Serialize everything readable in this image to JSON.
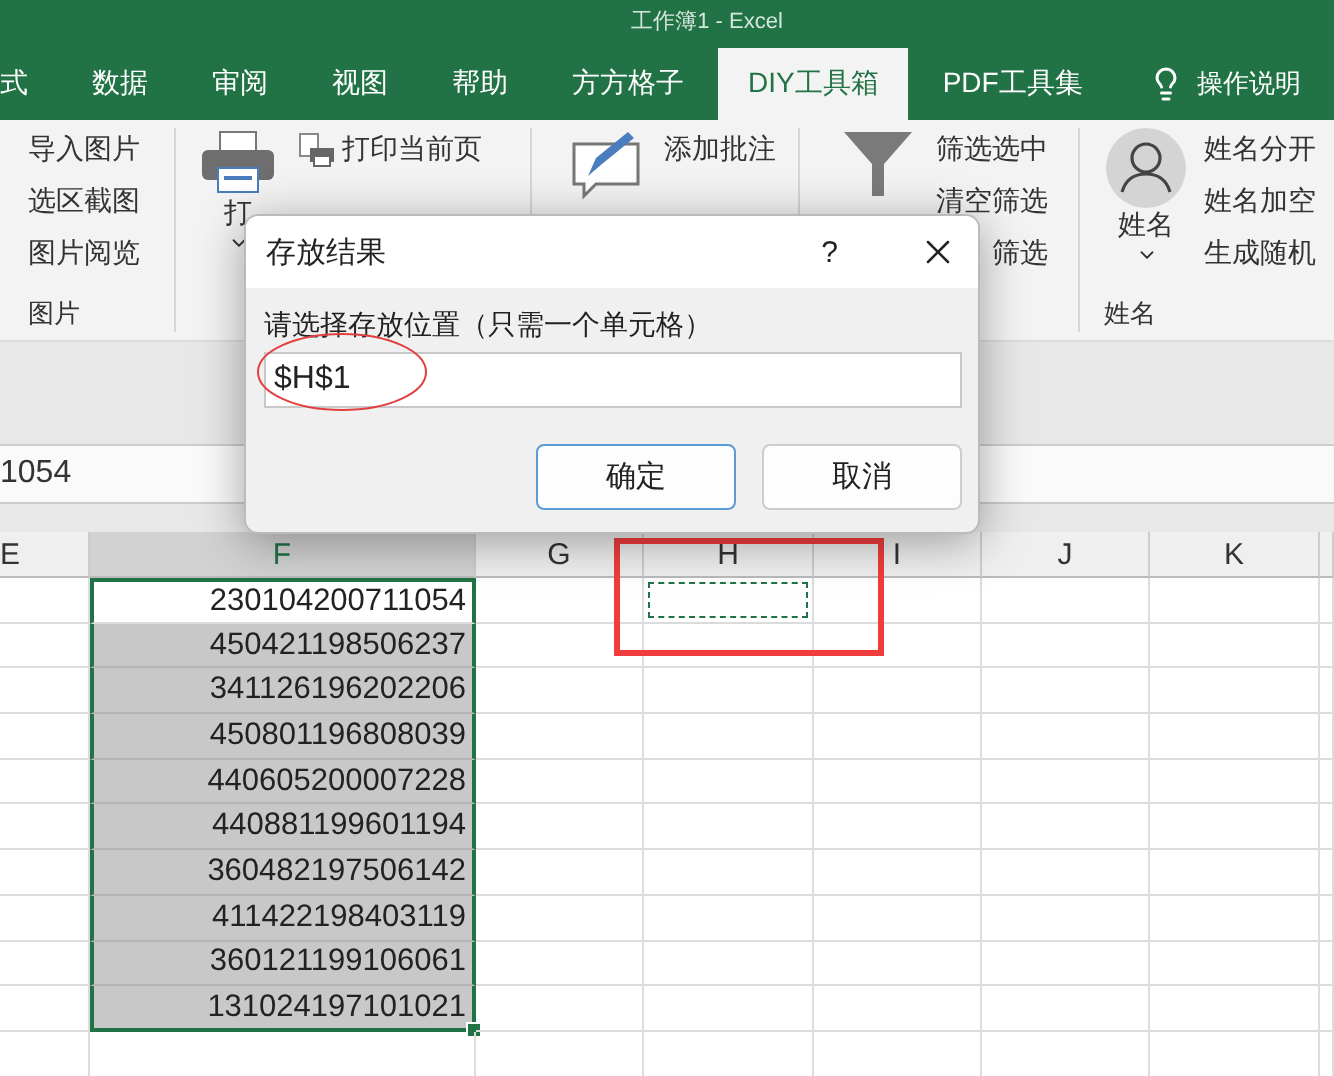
{
  "window": {
    "title": "工作簿1 - Excel"
  },
  "tabs": [
    {
      "label": "式",
      "selected": false
    },
    {
      "label": "数据",
      "selected": false
    },
    {
      "label": "审阅",
      "selected": false
    },
    {
      "label": "视图",
      "selected": false
    },
    {
      "label": "帮助",
      "selected": false
    },
    {
      "label": "方方格子",
      "selected": false
    },
    {
      "label": "DIY工具箱",
      "selected": true
    },
    {
      "label": "PDF工具集",
      "selected": false
    }
  ],
  "tell_me": {
    "label": "操作说明"
  },
  "ribbon": {
    "groups": [
      {
        "items": [
          {
            "label": "导入图片"
          },
          {
            "label": "选区截图"
          },
          {
            "label": "图片阅览"
          }
        ],
        "label": "图片"
      },
      {
        "button": {
          "kind": "printer",
          "label": "打",
          "dropdown": true
        },
        "items": [
          {
            "label": "打印当前页",
            "kind": "page"
          }
        ]
      },
      {
        "button": {
          "kind": "comment"
        },
        "items": [
          {
            "label": "添加批注"
          }
        ]
      },
      {
        "button": {
          "kind": "funnel"
        },
        "items": [
          {
            "label": "筛选选中"
          },
          {
            "label": "清空筛选"
          },
          {
            "label": "筛选",
            "covered": true
          }
        ]
      },
      {
        "button": {
          "kind": "person",
          "label": "姓名",
          "dropdown": true
        },
        "items": [
          {
            "label": "姓名分开"
          },
          {
            "label": "姓名加空"
          },
          {
            "label": "生成随机"
          }
        ],
        "label": "姓名"
      }
    ]
  },
  "formula_bar": {
    "value": "1054"
  },
  "sheet": {
    "columns": [
      {
        "label": "E",
        "selected": false,
        "marquee": false
      },
      {
        "label": "F",
        "selected": true,
        "marquee": false
      },
      {
        "label": "G",
        "selected": false,
        "marquee": false
      },
      {
        "label": "H",
        "selected": false,
        "marquee": true
      },
      {
        "label": "I",
        "selected": false,
        "marquee": false
      },
      {
        "label": "J",
        "selected": false,
        "marquee": false
      },
      {
        "label": "K",
        "selected": false,
        "marquee": false
      }
    ],
    "rows": [
      {
        "value": "230104200711054",
        "active": true
      },
      {
        "value": "450421198506237",
        "active": false
      },
      {
        "value": "341126196202206",
        "active": false
      },
      {
        "value": "450801196808039",
        "active": false
      },
      {
        "value": "440605200007228",
        "active": false
      },
      {
        "value": "440881199601194",
        "active": false
      },
      {
        "value": "360482197506142",
        "active": false
      },
      {
        "value": "411422198403119",
        "active": false
      },
      {
        "value": "360121199106061",
        "active": false
      },
      {
        "value": "131024197101021",
        "active": false
      }
    ]
  },
  "dialog": {
    "title": "存放结果",
    "help": "?",
    "prompt": "请选择存放位置（只需一个单元格）",
    "value": "$H$1",
    "buttons": [
      {
        "label": "确定",
        "default": true
      },
      {
        "label": "取消",
        "default": false
      }
    ]
  }
}
